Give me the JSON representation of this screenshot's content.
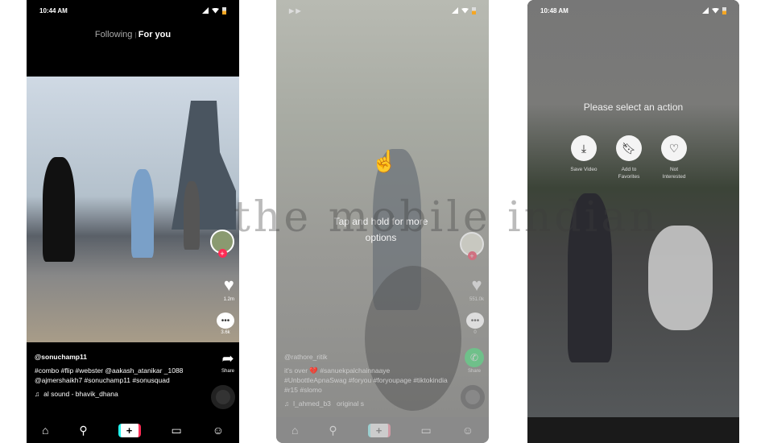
{
  "watermark": "the mobile indian",
  "phone1": {
    "time": "10:44 AM",
    "tabs": [
      "Following",
      "For you"
    ],
    "likes": "1.2m",
    "comments": "3.6k",
    "share": "Share",
    "username": "@sonuchamp11",
    "caption": "#combo #flip #webster @aakash_atanikar _1088 @ajmershaikh7 #sonuchamp11 #sonusquad",
    "sound": "al sound - bhavik_dhana"
  },
  "phone2": {
    "hint": "Tap and hold for more options",
    "likes": "551.0k",
    "comments": "0",
    "share": "Share",
    "username": "@rathore_ritik",
    "caption": "it's over 💔 #sanuekpalchainnaaye #UnbottleApnaSwag #foryou #foryoupage #tiktokindia #r15 #slomo",
    "sound_user": "l_ahmed_b3",
    "sound": "original s"
  },
  "phone3": {
    "time": "10:48 AM",
    "prompt": "Please select an action",
    "actions": [
      {
        "label": "Save Video",
        "icon": "download-icon"
      },
      {
        "label": "Add to Favorites",
        "icon": "bookmark-icon"
      },
      {
        "label": "Not Interested",
        "icon": "broken-heart-icon"
      }
    ]
  },
  "colors": {
    "accent_red": "#fe2c55",
    "accent_cyan": "#25f4ee",
    "battery": "#f5a623",
    "whatsapp": "#25d366"
  }
}
